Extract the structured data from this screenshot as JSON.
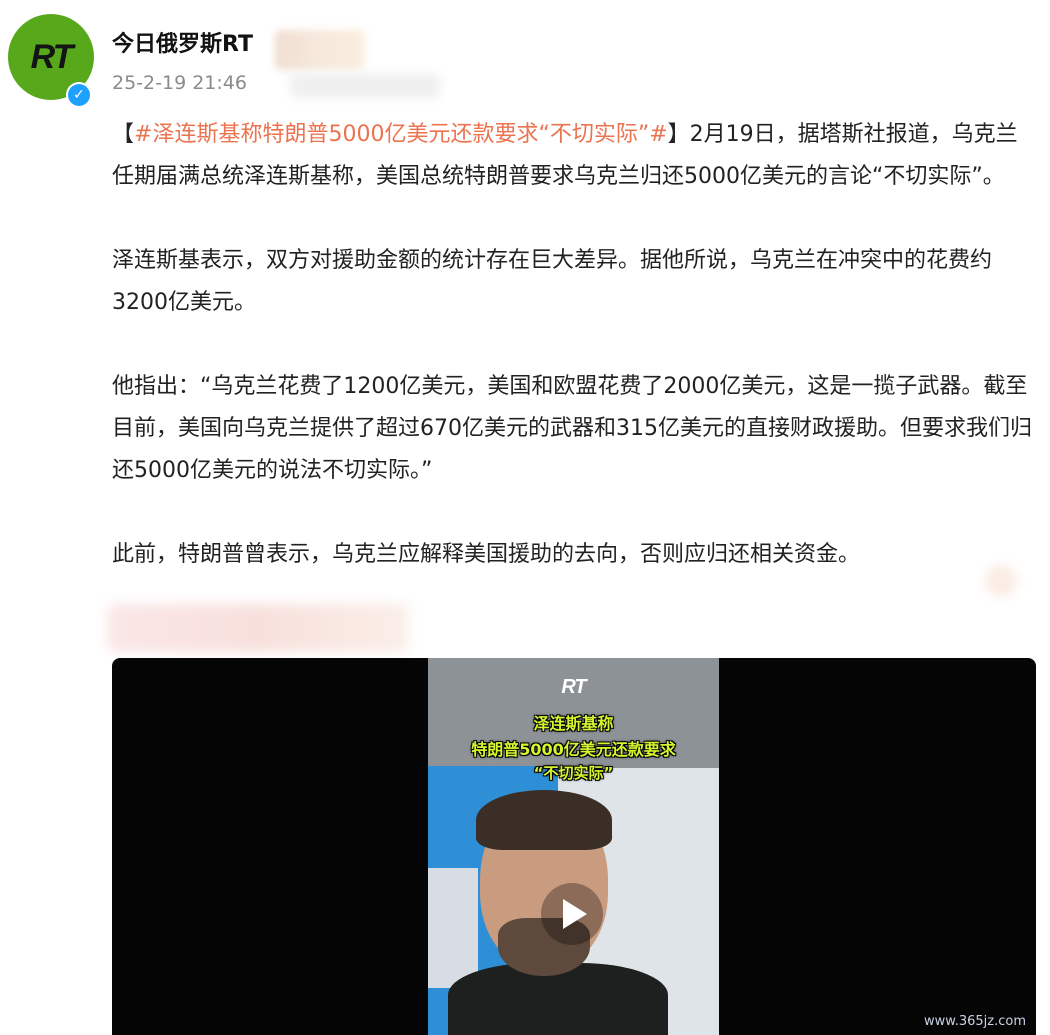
{
  "post": {
    "author": "今日俄罗斯RT",
    "timestamp": "25-2-19 21:46",
    "avatar_logo": "RT",
    "verified_icon": "verified-check-icon",
    "p1_bracket_open": "【",
    "p1_hashtag": "#泽连斯基称特朗普5000亿美元还款要求“不切实际”#",
    "p1_rest": "】2月19日，据塔斯社报道，乌克兰任期届满总统泽连斯基称，美国总统特朗普要求乌克兰归还5000亿美元的言论“不切实际”。",
    "p2": "泽连斯基表示，双方对援助金额的统计存在巨大差异。据他所说，乌克兰在冲突中的花费约3200亿美元。",
    "p3": "他指出：“乌克兰花费了1200亿美元，美国和欧盟花费了2000亿美元，这是一揽子武器。截至目前，美国向乌克兰提供了超过670亿美元的武器和315亿美元的直接财政援助。但要求我们归还5000亿美元的说法不切实际。”",
    "p4": "此前，特朗普曾表示，乌克兰应解释美国援助的去向，否则应归还相关资金。"
  },
  "video": {
    "logo": "RT",
    "caption_line1": "泽连斯基称",
    "caption_line2": "特朗普5000亿美元还款要求",
    "caption_line3": "“不切实际”",
    "play_icon": "play-icon"
  },
  "watermark": "www.365jz.com",
  "colors": {
    "hashtag": "#eb7350",
    "avatar_bg": "#58a81c",
    "verified": "#1ea0ff",
    "caption": "#d6f52e"
  }
}
